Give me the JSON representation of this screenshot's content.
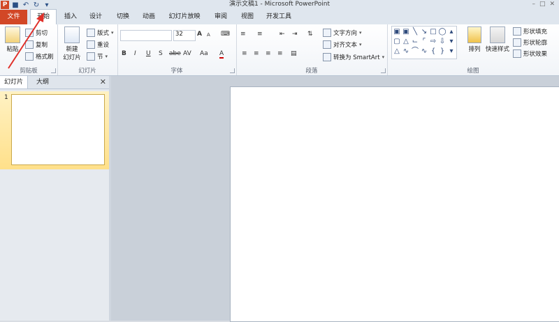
{
  "window": {
    "app_title": "演示文稿1 - Microsoft PowerPoint",
    "app_icon_letter": "P",
    "controls": [
      "–",
      "□",
      "✕"
    ]
  },
  "tabs": [
    {
      "label": "文件"
    },
    {
      "label": "开始"
    },
    {
      "label": "插入"
    },
    {
      "label": "设计"
    },
    {
      "label": "切换"
    },
    {
      "label": "动画"
    },
    {
      "label": "幻灯片放映"
    },
    {
      "label": "审阅"
    },
    {
      "label": "视图"
    },
    {
      "label": "开发工具"
    }
  ],
  "ribbon": {
    "clipboard": {
      "label": "剪贴板",
      "paste": "粘贴",
      "cut": "剪切",
      "copy": "复制",
      "format_painter": "格式刷"
    },
    "slides": {
      "label": "幻灯片",
      "new_slide_line1": "新建",
      "new_slide_line2": "幻灯片",
      "layout": "版式",
      "reset": "重设",
      "section": "节"
    },
    "font": {
      "label": "字体",
      "font_name": "",
      "font_size": "32",
      "bold": "B",
      "italic": "I",
      "underline": "U",
      "strike": "S",
      "shadow": "abe",
      "spacing": "AV",
      "case": "Aa",
      "color": "A",
      "grow": "A",
      "shrink": "A"
    },
    "paragraph": {
      "label": "段落",
      "text_direction": "文字方向",
      "align_text": "对齐文本",
      "smartart": "转换为 SmartArt"
    },
    "drawing": {
      "label": "绘图",
      "arrange": "排列",
      "quick_styles": "快速样式",
      "shape_fill": "形状填充",
      "shape_outline": "形状轮廓",
      "shape_effects": "形状效果"
    }
  },
  "left_panel": {
    "tab_slides": "幻灯片",
    "tab_outline": "大纲",
    "close": "✕",
    "slide_number": "1"
  },
  "colors": {
    "file_tab": "#d24726",
    "arrow": "#e0302a"
  }
}
